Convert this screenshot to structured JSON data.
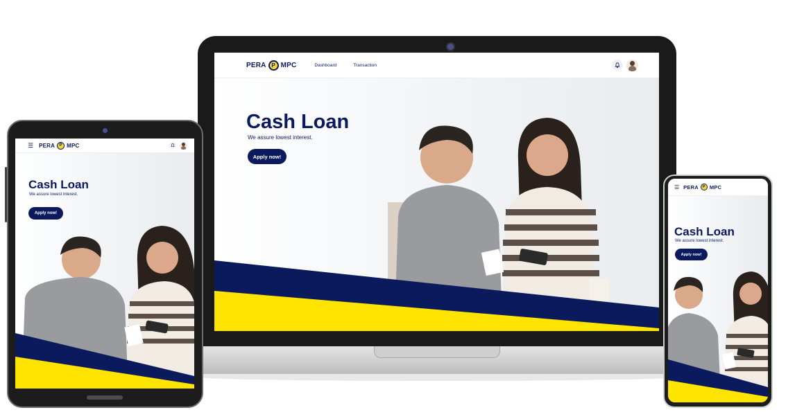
{
  "brand": {
    "name_left": "PERA",
    "mark": "P",
    "name_right": "MPC"
  },
  "nav": {
    "dashboard": "Dashboard",
    "transaction": "Transaction"
  },
  "icons": {
    "menu": "☰",
    "bell": "🔔"
  },
  "hero": {
    "title": "Cash Loan",
    "subtitle": "We assure lowest interest.",
    "cta": "Apply now!"
  },
  "colors": {
    "navy": "#0b1a5c",
    "yellow": "#ffe400",
    "frame": "#1b1b1b"
  }
}
